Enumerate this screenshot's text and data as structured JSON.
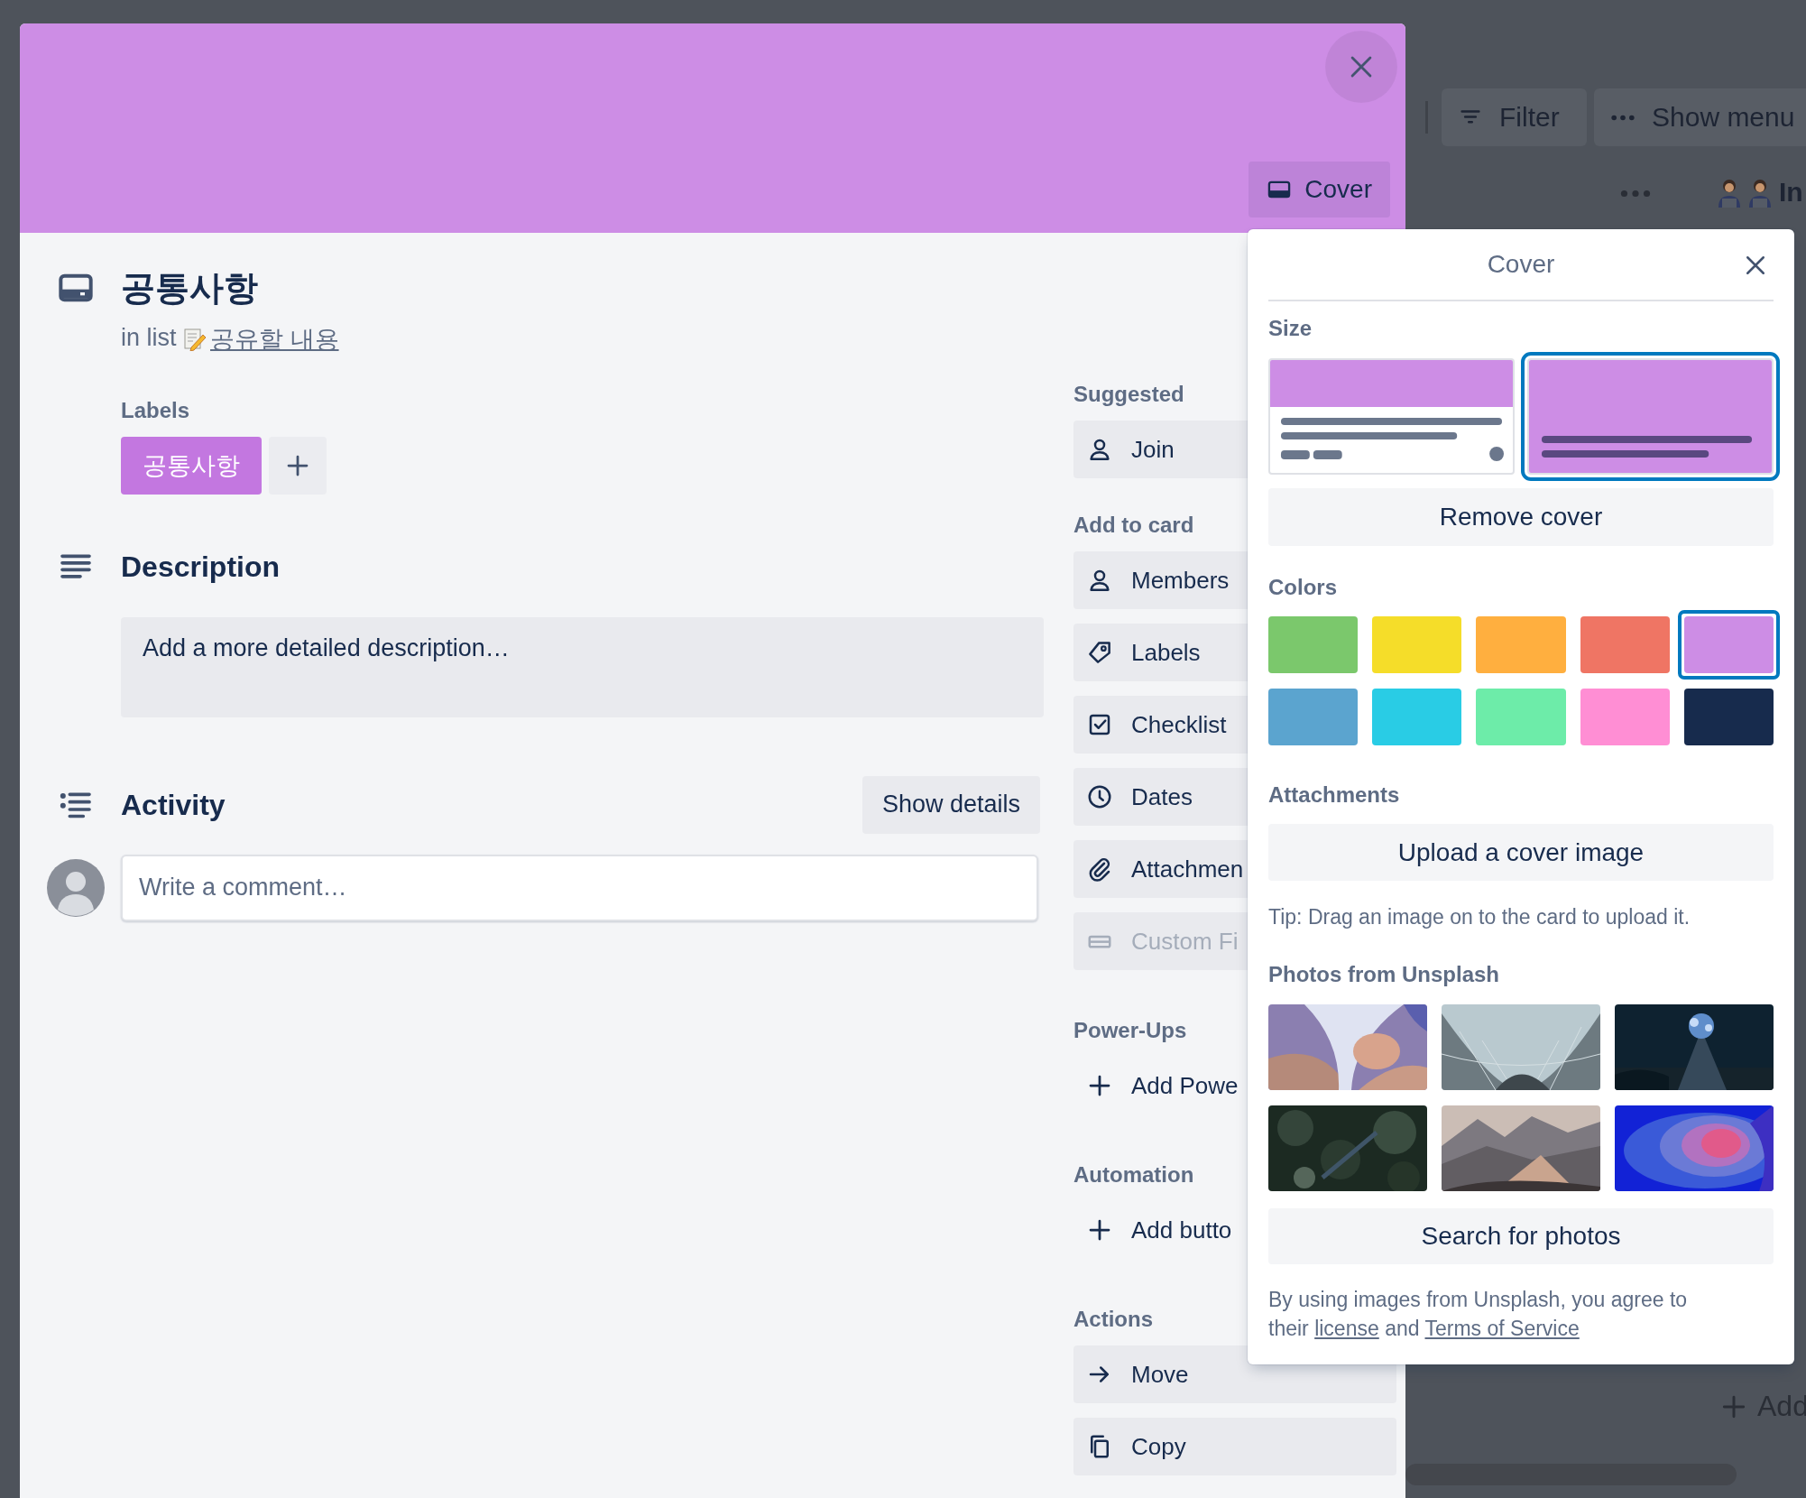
{
  "board": {
    "toolbar": [
      {
        "label": "Filter"
      },
      {
        "label": "Show menu"
      }
    ],
    "list_title": "In",
    "add_card": "Add"
  },
  "card": {
    "cover_button": "Cover",
    "title": "공통사항",
    "list_prefix": "in list",
    "list_name": "공유할 내용",
    "labels": {
      "heading": "Labels",
      "items": [
        {
          "name": "공통사항",
          "color": "#c377e0"
        }
      ]
    },
    "description": {
      "heading": "Description",
      "prompt": "Add a more detailed description…"
    },
    "activity": {
      "heading": "Activity",
      "show_details": "Show details",
      "comment": {
        "placeholder": "Write a comment…"
      }
    }
  },
  "sidebar": [
    {
      "heading": "Suggested",
      "items": [
        {
          "label": "Join",
          "kind": "button",
          "disabled": false
        }
      ]
    },
    {
      "heading": "Add to card",
      "items": [
        {
          "label": "Members",
          "kind": "button",
          "disabled": false
        },
        {
          "label": "Labels",
          "kind": "button",
          "disabled": false
        },
        {
          "label": "Checklist",
          "kind": "button",
          "disabled": false
        },
        {
          "label": "Dates",
          "kind": "button",
          "disabled": false
        },
        {
          "label": "Attachmen",
          "kind": "button",
          "disabled": false
        },
        {
          "label": "Custom Fi",
          "kind": "button",
          "disabled": true
        }
      ]
    },
    {
      "heading": "Power-Ups",
      "items": [
        {
          "label": "Add Powe",
          "kind": "link",
          "disabled": false
        }
      ]
    },
    {
      "heading": "Automation",
      "items": [
        {
          "label": "Add butto",
          "kind": "link",
          "disabled": false
        }
      ]
    },
    {
      "heading": "Actions",
      "items": [
        {
          "label": "Move",
          "kind": "button",
          "disabled": false
        },
        {
          "label": "Copy",
          "kind": "button",
          "disabled": false
        }
      ]
    }
  ],
  "cover_popover": {
    "title": "Cover",
    "size_heading": "Size",
    "sizes": [
      {
        "kind": "band",
        "selected": false
      },
      {
        "kind": "full",
        "selected": true
      }
    ],
    "remove_button": "Remove cover",
    "colors_heading": "Colors",
    "colors": [
      {
        "color": "#7bc86c",
        "selected": false
      },
      {
        "color": "#f5dd29",
        "selected": false
      },
      {
        "color": "#ffaf3f",
        "selected": false
      },
      {
        "color": "#ef7564",
        "selected": false
      },
      {
        "color": "#cd8de5",
        "selected": true
      },
      {
        "color": "#5ba4cf",
        "selected": false
      },
      {
        "color": "#29cce5",
        "selected": false
      },
      {
        "color": "#6deca9",
        "selected": false
      },
      {
        "color": "#ff8ed4",
        "selected": false
      },
      {
        "color": "#172b4d",
        "selected": false
      }
    ],
    "attachments_heading": "Attachments",
    "upload_button": "Upload a cover image",
    "tip": "Tip: Drag an image on to the card to upload it.",
    "photos_heading": "Photos from Unsplash",
    "search_button": "Search for photos",
    "terms": {
      "before": "By using images from Unsplash, you agree to their",
      "links": [
        "license",
        "Terms of Service"
      ],
      "joiner": "and"
    }
  }
}
